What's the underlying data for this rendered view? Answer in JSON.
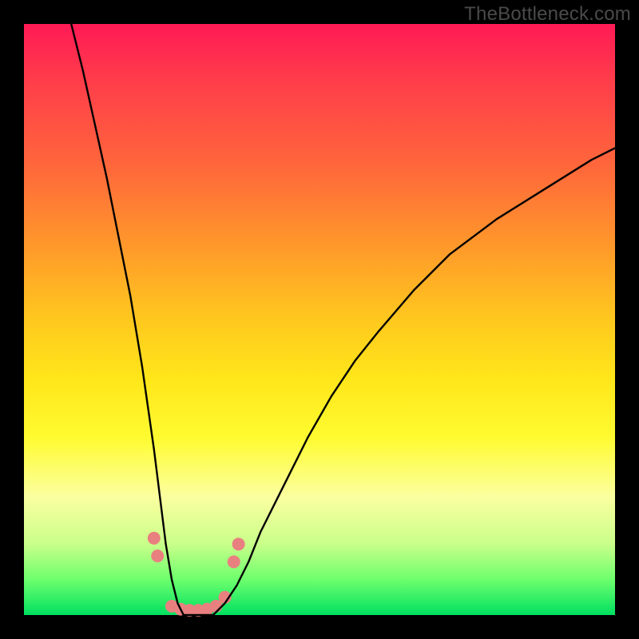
{
  "watermark": "TheBottleneck.com",
  "chart_data": {
    "type": "line",
    "title": "",
    "xlabel": "",
    "ylabel": "",
    "xlim": [
      0,
      100
    ],
    "ylim": [
      0,
      100
    ],
    "gradient_stops": [
      {
        "pos": 0,
        "color": "#ff1a55"
      },
      {
        "pos": 10,
        "color": "#ff3e4a"
      },
      {
        "pos": 25,
        "color": "#ff6a3a"
      },
      {
        "pos": 38,
        "color": "#ff9a2a"
      },
      {
        "pos": 50,
        "color": "#ffc81e"
      },
      {
        "pos": 60,
        "color": "#ffe61a"
      },
      {
        "pos": 70,
        "color": "#fffb30"
      },
      {
        "pos": 80,
        "color": "#fbffa0"
      },
      {
        "pos": 88,
        "color": "#c9ff8a"
      },
      {
        "pos": 94,
        "color": "#6dff6d"
      },
      {
        "pos": 100,
        "color": "#00e060"
      }
    ],
    "series": [
      {
        "name": "curve",
        "stroke": "#000000",
        "stroke_width": 2.4,
        "x": [
          8,
          10,
          12,
          14,
          16,
          18,
          20,
          21,
          22,
          23,
          24,
          25,
          26,
          27,
          28,
          30,
          32,
          34,
          36,
          38,
          40,
          44,
          48,
          52,
          56,
          60,
          66,
          72,
          80,
          88,
          96,
          100
        ],
        "y": [
          100,
          92,
          83,
          74,
          64,
          54,
          42,
          35,
          28,
          20,
          12,
          6,
          2,
          0,
          0,
          0,
          0,
          2,
          5,
          9,
          14,
          22,
          30,
          37,
          43,
          48,
          55,
          61,
          67,
          72,
          77,
          79
        ]
      }
    ],
    "markers": [
      {
        "x": 22.0,
        "y": 13.0,
        "color": "#e98080",
        "r": 8
      },
      {
        "x": 22.6,
        "y": 10.0,
        "color": "#e98080",
        "r": 8
      },
      {
        "x": 25.0,
        "y": 1.5,
        "color": "#e98080",
        "r": 8
      },
      {
        "x": 26.5,
        "y": 1.0,
        "color": "#e98080",
        "r": 8
      },
      {
        "x": 28.0,
        "y": 0.8,
        "color": "#e98080",
        "r": 8
      },
      {
        "x": 29.5,
        "y": 0.8,
        "color": "#e98080",
        "r": 8
      },
      {
        "x": 31.0,
        "y": 1.0,
        "color": "#e98080",
        "r": 8
      },
      {
        "x": 32.5,
        "y": 1.5,
        "color": "#e98080",
        "r": 8
      },
      {
        "x": 34.0,
        "y": 3.0,
        "color": "#e98080",
        "r": 8
      },
      {
        "x": 35.5,
        "y": 9.0,
        "color": "#e98080",
        "r": 8
      },
      {
        "x": 36.3,
        "y": 12.0,
        "color": "#e98080",
        "r": 8
      }
    ]
  }
}
